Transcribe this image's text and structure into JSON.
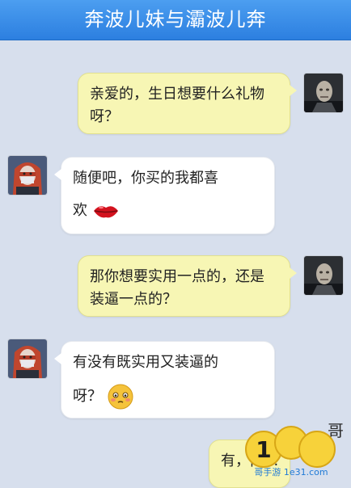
{
  "header": {
    "title": "奔波儿妹与灞波儿奔"
  },
  "messages": [
    {
      "side": "right",
      "lines": [
        "亲爱的，生日想要什么礼物",
        "呀？"
      ],
      "avatar": "male-avatar"
    },
    {
      "side": "left",
      "lines": [
        "随便吧，你买的我都喜",
        "欢"
      ],
      "emoji": "lips-emoji",
      "avatar": "female-avatar"
    },
    {
      "side": "right",
      "lines": [
        "那你想要实用一点的，还是",
        "装逼一点的？"
      ],
      "avatar": "male-avatar"
    },
    {
      "side": "left",
      "lines": [
        "有没有既实用又装逼的",
        "呀？"
      ],
      "emoji": "blush-face-emoji",
      "avatar": "female-avatar"
    },
    {
      "side": "right",
      "lines": [
        "有，内..."
      ],
      "avatar": "male-avatar"
    }
  ],
  "watermark": {
    "number": "1",
    "brand": "哥",
    "url": "哥手游 1e31.com"
  },
  "colors": {
    "header_bg": "#3a8de9",
    "chat_bg": "#d7dfed",
    "sent_bubble": "#f7f6b4",
    "received_bubble": "#ffffff"
  }
}
